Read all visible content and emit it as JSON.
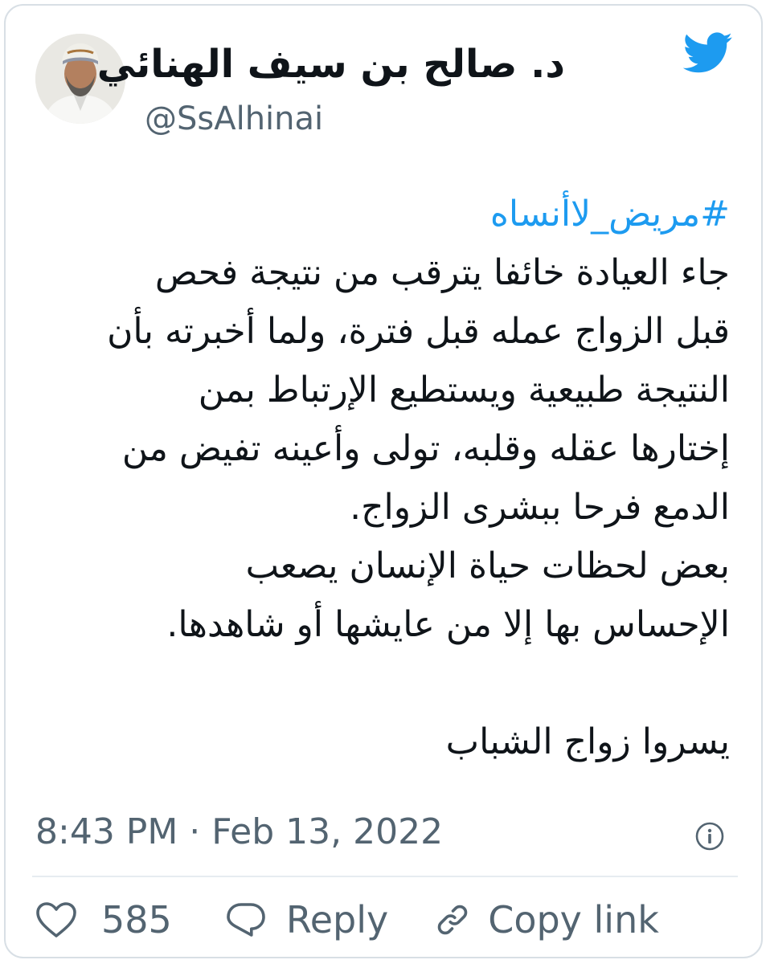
{
  "tweet": {
    "author": {
      "display_name": "د. صالح بن سيف الهنائي",
      "handle": "@SsAlhinai",
      "avatar_icon": "avatar-photo"
    },
    "brand_icon": "twitter-bird-icon",
    "hashtag": "#مريض_لاأنساه",
    "lines": [
      "جاء العيادة خائفا يترقب من نتيجة فحص",
      "قبل الزواج عمله قبل فترة، ولما أخبرته بأن",
      "النتيجة طبيعية ويستطيع الإرتباط بمن",
      "إختارها عقله وقلبه، تولى وأعينه تفيض من",
      "الدمع فرحا ببشرى الزواج.",
      "بعض لحظات حياة الإنسان يصعب",
      "الإحساس بها إلا من عايشها أو شاهدها."
    ],
    "closing_line": "يسروا زواج الشباب",
    "timestamp": "8:43 PM · Feb 13, 2022",
    "likes_count": "585",
    "reply_label": "Reply",
    "copy_link_label": "Copy link"
  },
  "colors": {
    "text": "#0f1419",
    "secondary": "#536471",
    "accent": "#1d9bf0",
    "border": "#d8dfe5"
  }
}
